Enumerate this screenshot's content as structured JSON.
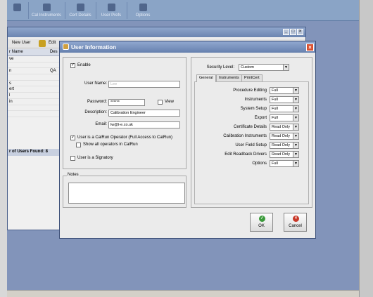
{
  "bg": {
    "toolbar": [
      "Cal Instruments",
      "Cert Details",
      "User Prefs",
      "Options"
    ],
    "window_tools": [
      "New User",
      "Edit"
    ],
    "columns": [
      "r Name",
      "Des"
    ],
    "rows": [
      {
        "c1": "ve",
        "c2": ""
      },
      {
        "c1": "",
        "c2": ""
      },
      {
        "c1": "n",
        "c2": "QA"
      },
      {
        "c1": "",
        "c2": ""
      },
      {
        "c1": "s",
        "c2": ""
      },
      {
        "c1": "ert",
        "c2": ""
      },
      {
        "c1": "l",
        "c2": ""
      },
      {
        "c1": "in",
        "c2": ""
      },
      {
        "c1": "",
        "c2": ""
      },
      {
        "c1": "",
        "c2": ""
      }
    ],
    "found_label": "r of Users Found: 8"
  },
  "dialog": {
    "title": "User Information",
    "enable_label": "Enable",
    "username_label": "User Name:",
    "username_value": "Lee",
    "password_label": "Password:",
    "password_value": "******",
    "view_label": "View",
    "description_label": "Description:",
    "description_value": "Calibration Engineer",
    "email_label": "Email:",
    "email_value": "lw@t-e.co.uk",
    "operator_label": "User is a CalRun Operator (Full Access to CalRun)",
    "show_ops_label": "Show all operators in CalRun",
    "signatory_label": "User is a Signatory",
    "notes_label": "Notes",
    "security_label": "Security Level:",
    "security_value": "Custom",
    "tabs": [
      "General",
      "Instruments",
      "PrintCert"
    ],
    "perms": [
      {
        "label": "Procedure Editing",
        "value": "Full"
      },
      {
        "label": "Instruments",
        "value": "Full"
      },
      {
        "label": "System Setup",
        "value": "Full"
      },
      {
        "label": "Export",
        "value": "Full"
      },
      {
        "label": "Certificate Details",
        "value": "Read Only"
      },
      {
        "label": "Calibration Instruments",
        "value": "Read Only"
      },
      {
        "label": "User Field Setup",
        "value": "Read Only"
      },
      {
        "label": "Edit Readback Drivers",
        "value": "Read Only"
      },
      {
        "label": "Options",
        "value": "Full"
      }
    ],
    "ok_label": "OK",
    "cancel_label": "Cancel",
    "enable_checked": "✓",
    "operator_checked": "✓"
  }
}
